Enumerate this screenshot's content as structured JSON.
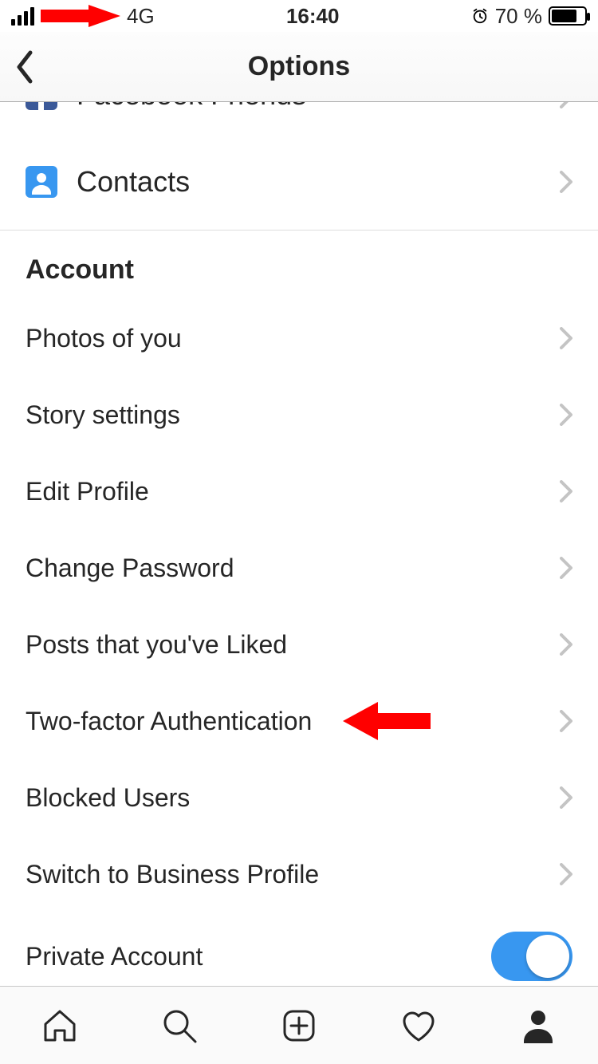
{
  "status": {
    "network": "4G",
    "time": "16:40",
    "battery_text": "70 %"
  },
  "header": {
    "title": "Options"
  },
  "follow_section": {
    "facebook_label": "Facebook Friends",
    "contacts_label": "Contacts"
  },
  "account": {
    "header": "Account",
    "items": {
      "photos_of_you": "Photos of you",
      "story_settings": "Story settings",
      "edit_profile": "Edit Profile",
      "change_password": "Change Password",
      "posts_liked": "Posts that you've Liked",
      "two_factor": "Two-factor Authentication",
      "blocked_users": "Blocked Users",
      "switch_business": "Switch to Business Profile",
      "private_account": "Private Account"
    },
    "private_account_on": true
  }
}
